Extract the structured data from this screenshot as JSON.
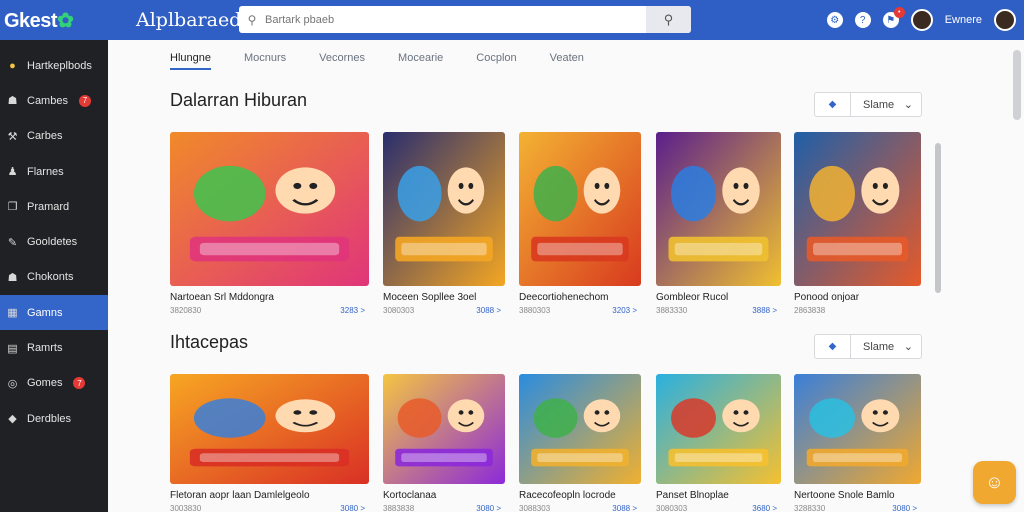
{
  "header": {
    "logo": "Gkest",
    "logo_accent": "✿",
    "app_title": "Alplbaraed",
    "search_placeholder": "Bartark pbaeb",
    "username": "Ewnere"
  },
  "sidebar": {
    "items": [
      {
        "label": "Hartkeplbods",
        "icon": "coin-icon",
        "badge": ""
      },
      {
        "label": "Cambes",
        "icon": "people-icon",
        "badge": "7"
      },
      {
        "label": "Carbes",
        "icon": "wrench-icon",
        "badge": ""
      },
      {
        "label": "Flarnes",
        "icon": "person-icon",
        "badge": ""
      },
      {
        "label": "Pramard",
        "icon": "bookmark-icon",
        "badge": ""
      },
      {
        "label": "Gooldetes",
        "icon": "tools-icon",
        "badge": ""
      },
      {
        "label": "Chokonts",
        "icon": "group-icon",
        "badge": ""
      },
      {
        "label": "Gamns",
        "icon": "store-icon",
        "badge": "",
        "active": true
      },
      {
        "label": "Ramrts",
        "icon": "grid-icon",
        "badge": ""
      },
      {
        "label": "Gomes",
        "icon": "gamepad-icon",
        "badge": "7"
      },
      {
        "label": "Derdbles",
        "icon": "tag-icon",
        "badge": ""
      }
    ]
  },
  "tabs": [
    "Hlungne",
    "Mocnurs",
    "Vecornes",
    "Mocearie",
    "Cocplon",
    "Veaten"
  ],
  "sections": [
    {
      "title": "Dalarran Hiburan",
      "select": "Slame",
      "cards": [
        {
          "name": "Nartoean Srl Mddongra",
          "meta": "3820830",
          "price": "3283 >"
        },
        {
          "name": "Moceen Sopllee 3oel",
          "meta": "3080303",
          "price": "3088 >"
        },
        {
          "name": "Deecortiohenechom",
          "meta": "3880303",
          "price": "3203 >"
        },
        {
          "name": "Gombleor Rucol",
          "meta": "3883330",
          "price": "3888 >"
        },
        {
          "name": "Ponood onjoar",
          "meta": "2863838",
          "price": ""
        }
      ]
    },
    {
      "title": "Ihtacepas",
      "select": "Slame",
      "cards": [
        {
          "name": "Fletoran aopr laan Damlelgeolo",
          "meta": "3003830",
          "price": "3080 >"
        },
        {
          "name": "Kortoclanaa",
          "meta": "3883838",
          "price": "3080 >"
        },
        {
          "name": "Racecofeopln locrode",
          "meta": "3088303",
          "price": "3088 >"
        },
        {
          "name": "Panset Blnoplae",
          "meta": "3080303",
          "price": "3680 >"
        },
        {
          "name": "Nertoone Snole Bamlo",
          "meta": "3288330",
          "price": "3080 >"
        }
      ]
    }
  ],
  "colors": {
    "topbar": "#2f5fc4",
    "sidebar": "#1f2124",
    "active": "#3465c9",
    "chat": "#f0a830"
  }
}
